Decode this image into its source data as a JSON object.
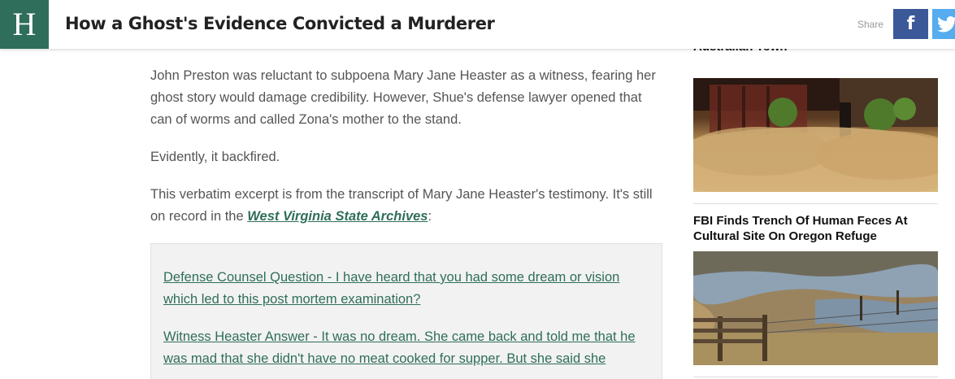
{
  "header": {
    "logo_letter": "H",
    "title": "How a Ghost's Evidence Convicted a Murderer",
    "share_label": "Share",
    "facebook_label": "f",
    "logo_color": "#2f6e5a",
    "facebook_color": "#3b5998",
    "twitter_color": "#55acee"
  },
  "article": {
    "paragraph1": "John Preston was reluctant to subpoena Mary Jane Heaster as a witness, fearing her ghost story would damage credibility. However, Shue's defense lawyer opened that can of worms and called Zona's mother to the stand.",
    "paragraph2": "Evidently, it backfired.",
    "paragraph3_text": "This verbatim excerpt is from the transcript of Mary Jane Heaster's testimony. It's still on record in the ",
    "paragraph3_link": "West Virginia State Archives",
    "paragraph3_end": ":",
    "quote": {
      "question": "Defense Counsel Question - I have heard that you had some dream or vision which led to this post mortem examination?",
      "answer": "Witness Heaster Answer - It was no dream. She came back and told me that he was mad that she didn't have no meat cooked for supper. But she said she"
    }
  },
  "sidebar": {
    "items": [
      {
        "title": "'Hairy Panic' Overwhelms Rural Australian Town",
        "visible_title": "Australian Town"
      },
      {
        "title": "FBI Finds Trench Of Human Feces At Cultural Site On Oregon Refuge"
      }
    ]
  }
}
